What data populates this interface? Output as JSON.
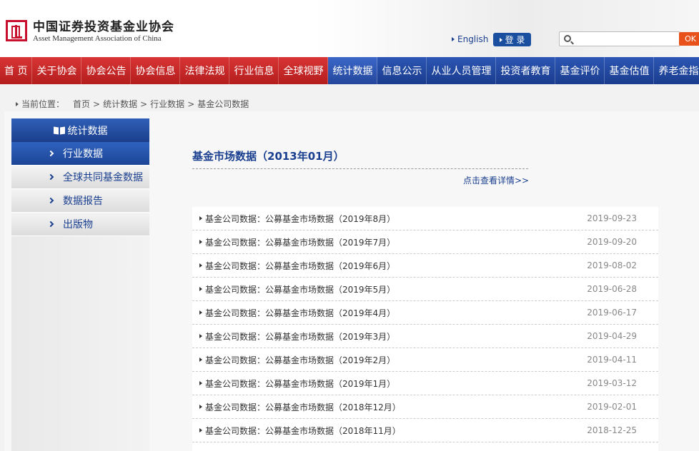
{
  "header": {
    "logo_cn": "中国证券投资基金业协会",
    "logo_en": "Asset Management Association of China",
    "english_link": "English",
    "login_label": "登 录",
    "search_placeholder": "",
    "search_button": "OK"
  },
  "nav": {
    "items": [
      {
        "label": "首 页"
      },
      {
        "label": "关于协会"
      },
      {
        "label": "协会公告"
      },
      {
        "label": "协会信息"
      },
      {
        "label": "法律法规"
      },
      {
        "label": "行业信息"
      },
      {
        "label": "全球视野"
      },
      {
        "label": "统计数据"
      },
      {
        "label": "信息公示"
      },
      {
        "label": "从业人员管理"
      },
      {
        "label": "投资者教育"
      },
      {
        "label": "基金评价"
      },
      {
        "label": "基金估值"
      },
      {
        "label": "养老金指数"
      }
    ]
  },
  "breadcrumb": {
    "prefix": "当前位置：",
    "items": [
      "首页",
      "统计数据",
      "行业数据",
      "基金公司数据"
    ],
    "sep": ">"
  },
  "sidebar": {
    "title": "统计数据",
    "items": [
      {
        "label": "行业数据"
      },
      {
        "label": "全球共同基金数据"
      },
      {
        "label": "数据报告"
      },
      {
        "label": "出版物"
      }
    ]
  },
  "main": {
    "title": "基金市场数据（2013年01月）",
    "detail_link": "点击查看详情>>",
    "rows": [
      {
        "title": "基金公司数据：公募基金市场数据（2019年8月）",
        "date": "2019-09-23"
      },
      {
        "title": "基金公司数据：公募基金市场数据（2019年7月）",
        "date": "2019-09-20"
      },
      {
        "title": "基金公司数据：公募基金市场数据（2019年6月）",
        "date": "2019-08-02"
      },
      {
        "title": "基金公司数据：公募基金市场数据（2019年5月）",
        "date": "2019-06-28"
      },
      {
        "title": "基金公司数据：公募基金市场数据（2019年4月）",
        "date": "2019-06-17"
      },
      {
        "title": "基金公司数据：公募基金市场数据（2019年3月）",
        "date": "2019-04-29"
      },
      {
        "title": "基金公司数据：公募基金市场数据（2019年2月）",
        "date": "2019-04-11"
      },
      {
        "title": "基金公司数据：公募基金市场数据（2019年1月）",
        "date": "2019-03-12"
      },
      {
        "title": "基金公司数据：公募基金市场数据（2018年12月）",
        "date": "2019-02-01"
      },
      {
        "title": "基金公司数据：公募基金市场数据（2018年11月）",
        "date": "2018-12-25"
      }
    ]
  },
  "colors": {
    "nav_red": "#c62828",
    "nav_blue": "#1a3c8e",
    "link_blue": "#1a3f8f",
    "search_orange": "#e8521a"
  }
}
